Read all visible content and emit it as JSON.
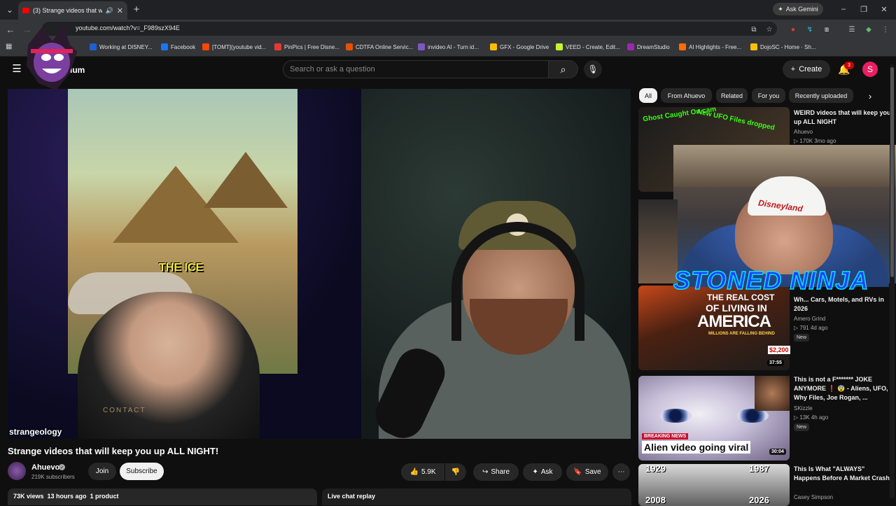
{
  "browser": {
    "tab": {
      "title": "(3) Strange videos that will k",
      "close": "✕",
      "sound": "🔊"
    },
    "new_tab": "+",
    "ask_gemini": "Ask Gemini",
    "url": "youtube.com/watch?v=_F989szX94E",
    "bookmarks": [
      {
        "label": "Working at DISNEY...",
        "color": "#1f5fd0"
      },
      {
        "label": "Facebook",
        "color": "#1877f2"
      },
      {
        "label": "[TOMT](youtube vid...",
        "color": "#ff4500"
      },
      {
        "label": "PinPics | Free Disne...",
        "color": "#e53935"
      },
      {
        "label": "CDTFA Online Servic...",
        "color": "#e65100"
      },
      {
        "label": "invideo AI - Turn id...",
        "color": "#7e57c2"
      },
      {
        "label": "GFX - Google Drive",
        "color": "#fbbc04"
      },
      {
        "label": "VEED - Create, Edit...",
        "color": "#c6f432"
      },
      {
        "label": "DreamStudio",
        "color": "#9c27b0"
      },
      {
        "label": "AI Highlights - Free...",
        "color": "#ff6d00"
      },
      {
        "label": "DojoSC - Home · Sh...",
        "color": "#ffc107"
      }
    ]
  },
  "header": {
    "brand_suffix": "ium",
    "search_placeholder": "Search or ask a question",
    "create_label": "Create",
    "notification_count": "3",
    "avatar_letter": "S"
  },
  "player": {
    "caption": "THE ICE",
    "watermark": "strangeology",
    "shirt_text": "CONTACT"
  },
  "video": {
    "title": "Strange videos that will keep you up ALL NIGHT!",
    "channel": "Ahuevo",
    "subscribers": "219K subscribers",
    "join": "Join",
    "subscribe": "Subscribe",
    "likes": "5.9K",
    "share": "Share",
    "ask": "Ask",
    "save": "Save",
    "meta": "73K views  13 hours ago  1 product",
    "live_chat": "Live chat replay"
  },
  "chips": [
    "All",
    "From Ahuevo",
    "Related",
    "For you",
    "Recently uploaded"
  ],
  "recommendations": [
    {
      "title": "WEIRD videos that will keep you up ALL NIGHT",
      "channel": "Ahuevo",
      "stats": "▷ 170K  3mo ago",
      "thumb_text_1": "Ghost Caught On cam",
      "thumb_text_2": "New UFO Files dropped"
    },
    {
      "title": "Wh... Cars, Motels, and RVs in 2026",
      "channel": "Amero Grind",
      "stats": "▷ 791  4d ago",
      "badge": "New",
      "duration": "37:55",
      "thumb_line_1": "THE REAL COST",
      "thumb_line_2": "OF LIVING IN",
      "thumb_line_3": "AMERICA",
      "thumb_line_4": "MILLIONS ARE FALLING BEHIND",
      "thumb_price": "$2,200"
    },
    {
      "title": "This is not a F******* JOKE ANYMORE ❗ 😨 - Aliens, UFO, Why Files, Joe Rogan, ...",
      "channel": "SKizzle",
      "stats": "▷ 13K  4h ago",
      "badge": "New",
      "duration": "30:04",
      "breaking": "BREAKING NEWS",
      "headline": "Alien video going viral"
    },
    {
      "title": "This Is What \"ALWAYS\" Happens Before A Market Crash",
      "channel": "Casey Simpson",
      "year_1": "1929",
      "year_2": "1987",
      "year_3": "2008",
      "year_4": "2026"
    }
  ],
  "overlay": {
    "text": "STONED NINJA",
    "cap_text": "Disneyland"
  }
}
